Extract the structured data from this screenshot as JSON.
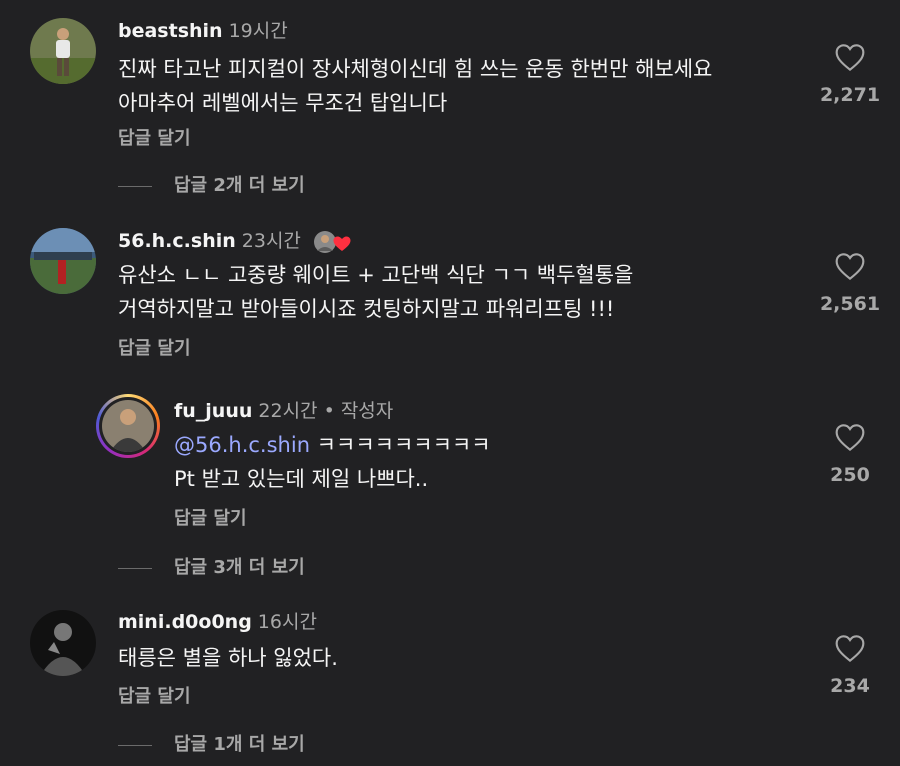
{
  "comments": [
    {
      "username": "beastshin",
      "time": "19시간",
      "lines": [
        "진짜 타고난 피지컬이 장사체형이신데 힘 쓰는 운동 한번만 해보세요",
        "아마추어 레벨에서는 무조건 탑입니다"
      ],
      "reply_label": "답글 달기",
      "likes": "2,271",
      "view_replies": "답글 2개 더 보기"
    },
    {
      "username": "56.h.c.shin",
      "time": "23시간",
      "lines": [
        "유산소 ㄴㄴ 고중량 웨이트 + 고단백 식단 ㄱㄱ 백두혈통을",
        "거역하지말고 받아들이시죠  컷팅하지말고 파워리프팅 !!!"
      ],
      "reply_label": "답글 달기",
      "likes": "2,561"
    },
    {
      "username": "fu_juuu",
      "time": "22시간",
      "author_label": "• 작성자",
      "mention": "@56.h.c.shin",
      "line1_rest": " ㅋㅋㅋㅋㅋㅋㅋㅋㅋ",
      "line2": "Pt 받고 있는데 제일 나쁘다..",
      "reply_label": "답글 달기",
      "likes": "250",
      "view_replies": "답글 3개 더 보기"
    },
    {
      "username": "mini.d0o0ng",
      "time": "16시간",
      "lines": [
        "태릉은 별을 하나 잃었다."
      ],
      "reply_label": "답글 달기",
      "likes": "234",
      "view_replies": "답글 1개 더 보기"
    }
  ],
  "colors": {
    "background": "#212123",
    "text": "#f5f5f5",
    "muted": "#a8a8a8",
    "mention": "#9ba9ff",
    "heart_badge": "#ff3040"
  },
  "icons": {
    "like": "heart-outline-icon",
    "creator_liked": "heart-filled-icon"
  }
}
